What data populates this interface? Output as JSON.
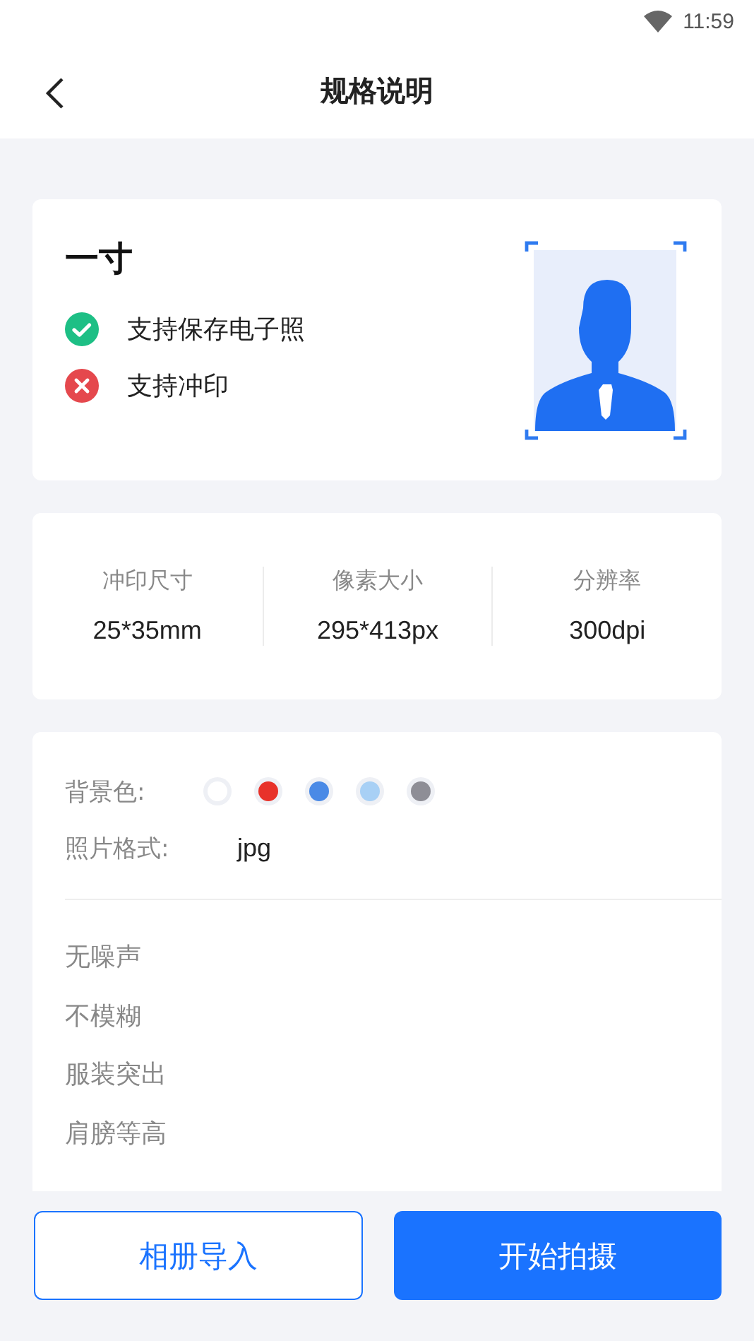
{
  "status_bar": {
    "time": "11:59"
  },
  "header": {
    "title": "规格说明"
  },
  "spec": {
    "name": "一寸",
    "features": [
      {
        "label": "支持保存电子照",
        "supported": true
      },
      {
        "label": "支持冲印",
        "supported": false
      }
    ]
  },
  "sizes": [
    {
      "label": "冲印尺寸",
      "value": "25*35mm"
    },
    {
      "label": "像素大小",
      "value": "295*413px"
    },
    {
      "label": "分辨率",
      "value": "300dpi"
    }
  ],
  "background": {
    "label": "背景色:",
    "colors": [
      {
        "color": "#ffffff"
      },
      {
        "color": "#e8322a"
      },
      {
        "color": "#4a8ae6"
      },
      {
        "color": "#a8d0f5"
      },
      {
        "color": "#8e8e96"
      }
    ]
  },
  "format": {
    "label": "照片格式:",
    "value": "jpg"
  },
  "requirements": [
    "无噪声",
    "不模糊",
    "服装突出",
    "肩膀等高"
  ],
  "buttons": [
    {
      "label": "相册导入",
      "kind": "outline"
    },
    {
      "label": "开始拍摄",
      "kind": "primary"
    }
  ]
}
